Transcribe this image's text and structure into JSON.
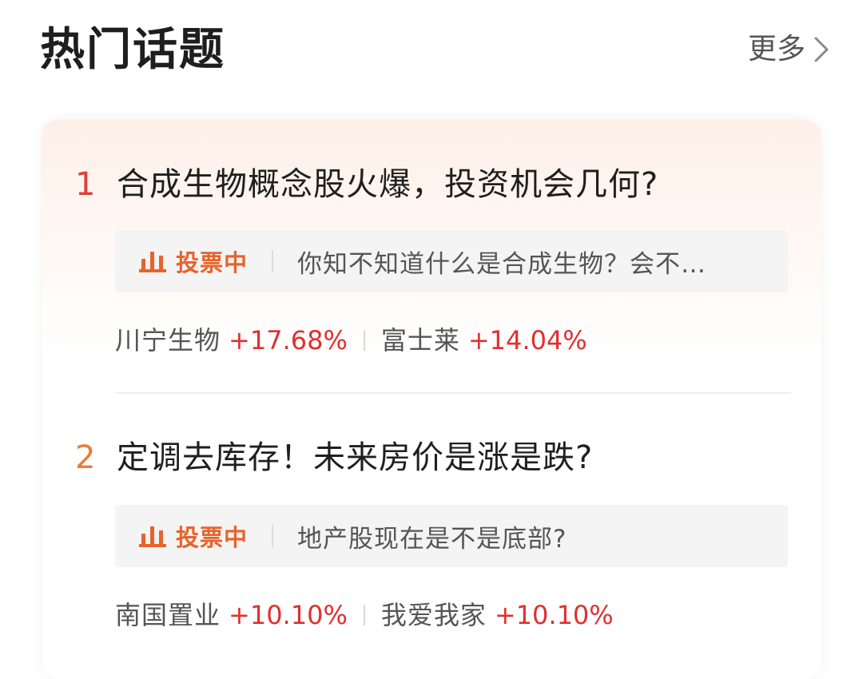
{
  "header": {
    "title": "热门话题",
    "more_label": "更多"
  },
  "topics": [
    {
      "rank": "1",
      "rank_color": "#d9413a",
      "title": "合成生物概念股火爆，投资机会几何?",
      "vote_label": "投票中",
      "vote_question": "你知不知道什么是合成生物？会不…",
      "stocks": [
        {
          "name": "川宁生物",
          "change": "+17.68%"
        },
        {
          "name": "富士莱",
          "change": "+14.04%"
        }
      ]
    },
    {
      "rank": "2",
      "rank_color": "#ec7a35",
      "title": "定调去库存！未来房价是涨是跌?",
      "vote_label": "投票中",
      "vote_question": "地产股现在是不是底部?",
      "stocks": [
        {
          "name": "南国置业",
          "change": "+10.10%"
        },
        {
          "name": "我爱我家",
          "change": "+10.10%"
        }
      ]
    }
  ],
  "colors": {
    "accent_orange": "#e8632a",
    "rise_red": "#e02f2f"
  },
  "icons": {
    "more": "chevron-right-icon",
    "vote": "bar-chart-icon"
  }
}
